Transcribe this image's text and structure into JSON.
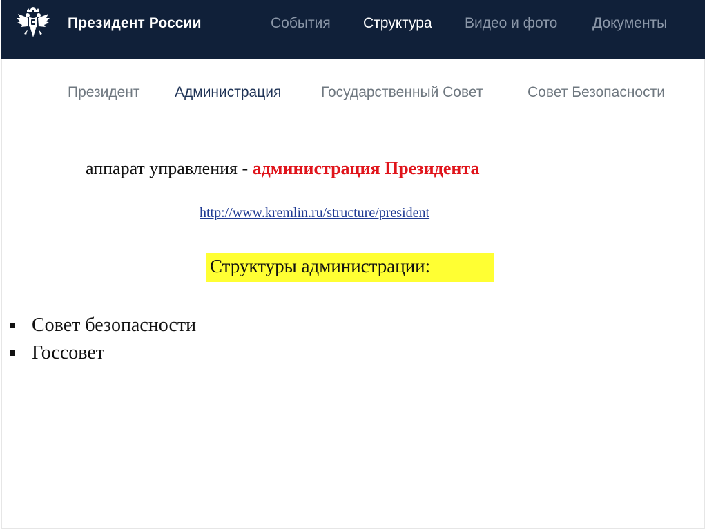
{
  "header": {
    "emblem_icon": "double-headed-eagle-icon",
    "site_title": "Президент России",
    "nav": [
      {
        "label": "События",
        "active": false
      },
      {
        "label": "Структура",
        "active": true
      },
      {
        "label": "Видео и фото",
        "active": false
      },
      {
        "label": "Документы",
        "active": false
      }
    ]
  },
  "sub_nav": [
    {
      "label": "Президент",
      "active": false
    },
    {
      "label": "Администрация",
      "active": true
    },
    {
      "label": "Государственный Совет",
      "active": false
    },
    {
      "label": "Совет Безопасности",
      "active": false
    }
  ],
  "content": {
    "headline_prefix": "аппарат управления -",
    "headline_accent": "администрация Президента",
    "source_link": "http://www.kremlin.ru/structure/president",
    "section_heading": "Структуры администрации:",
    "bullets": [
      "Совет безопасности",
      "Госсовет"
    ]
  },
  "colors": {
    "header_bg": "#102039",
    "nav_inactive": "#8b97a8",
    "sub_nav_active": "#1f3356",
    "accent_red": "#e0141b",
    "highlight_yellow": "#ffff33",
    "link_blue": "#1f3a93"
  }
}
